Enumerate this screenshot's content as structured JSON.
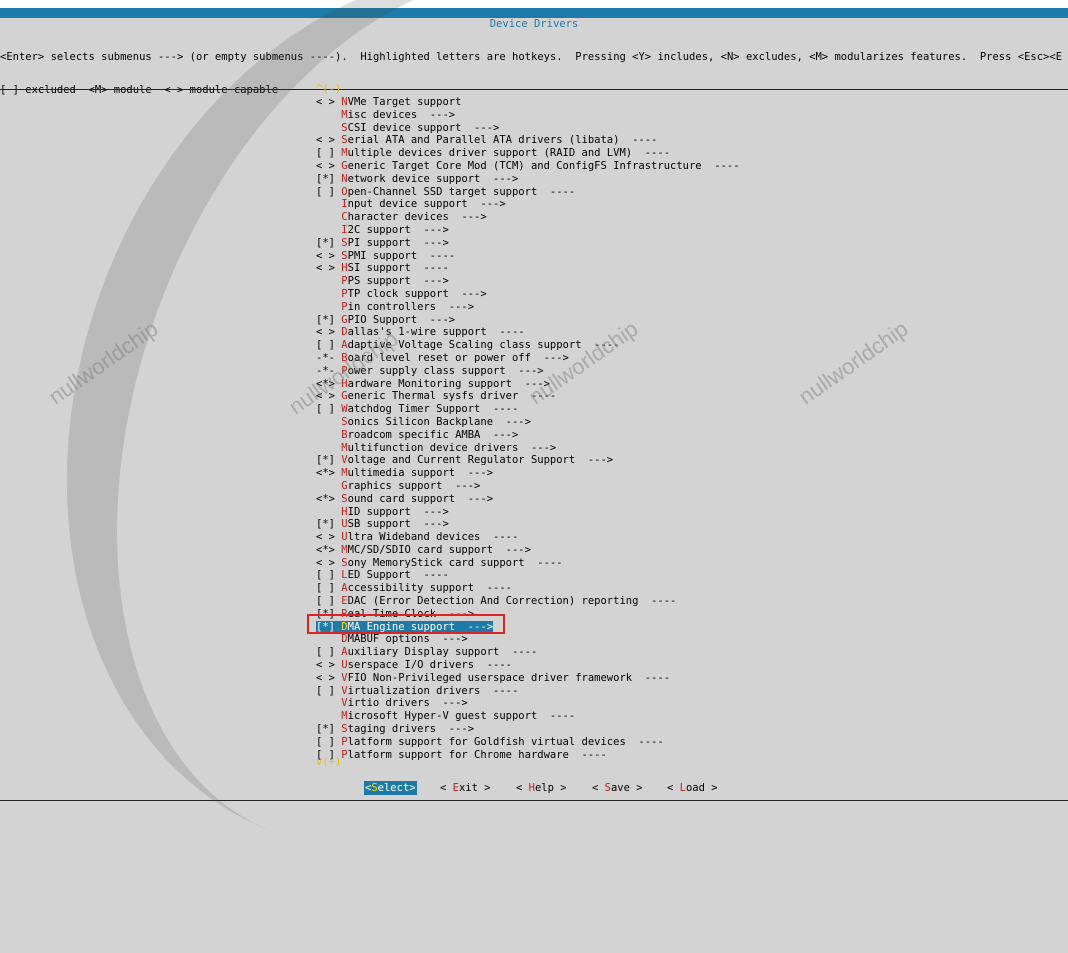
{
  "window": {
    "title": "Device Drivers",
    "help_line1": "<Enter> selects submenus ---> (or empty submenus ----).  Highlighted letters are hotkeys.  Pressing <Y> includes, <N> excludes, <M> modularizes features.  Press <Esc><E",
    "help_line2": "[ ] excluded  <M> module  < > module capable"
  },
  "scroll": {
    "top": "^(-)",
    "bottom": "v(+)"
  },
  "menu": [
    {
      "prefix": "< > ",
      "hot": "N",
      "rest": "VMe Target support"
    },
    {
      "prefix": "    ",
      "hot": "M",
      "rest": "isc devices  --->"
    },
    {
      "prefix": "    ",
      "hot": "S",
      "rest": "CSI device support  --->"
    },
    {
      "prefix": "< > ",
      "hot": "S",
      "rest": "erial ATA and Parallel ATA drivers (libata)  ----"
    },
    {
      "prefix": "[ ] ",
      "hot": "M",
      "rest": "ultiple devices driver support (RAID and LVM)  ----"
    },
    {
      "prefix": "< > ",
      "hot": "G",
      "rest": "eneric Target Core Mod (TCM) and ConfigFS Infrastructure  ----"
    },
    {
      "prefix": "[*] ",
      "hot": "N",
      "rest": "etwork device support  --->"
    },
    {
      "prefix": "[ ] ",
      "hot": "O",
      "rest": "pen-Channel SSD target support  ----"
    },
    {
      "prefix": "    ",
      "hot": "I",
      "rest": "nput device support  --->"
    },
    {
      "prefix": "    ",
      "hot": "C",
      "rest": "haracter devices  --->"
    },
    {
      "prefix": "    ",
      "hot": "I",
      "rest": "2C support  --->"
    },
    {
      "prefix": "[*] ",
      "hot": "S",
      "rest": "PI support  --->"
    },
    {
      "prefix": "< > ",
      "hot": "S",
      "rest": "PMI support  ----"
    },
    {
      "prefix": "< > ",
      "hot": "H",
      "rest": "SI support  ----"
    },
    {
      "prefix": "    ",
      "hot": "P",
      "rest": "PS support  --->"
    },
    {
      "prefix": "    ",
      "hot": "P",
      "rest": "TP clock support  --->"
    },
    {
      "prefix": "    ",
      "hot": "P",
      "rest": "in controllers  --->"
    },
    {
      "prefix": "[*] ",
      "hot": "G",
      "rest": "PIO Support  --->"
    },
    {
      "prefix": "< > ",
      "hot": "D",
      "rest": "allas's 1-wire support  ----"
    },
    {
      "prefix": "[ ] ",
      "hot": "A",
      "rest": "daptive Voltage Scaling class support  ----"
    },
    {
      "prefix": "-*- ",
      "hot": "B",
      "rest": "oard level reset or power off  --->"
    },
    {
      "prefix": "-*- ",
      "hot": "P",
      "rest": "ower supply class support  --->"
    },
    {
      "prefix": "<*> ",
      "hot": "H",
      "rest": "ardware Monitoring support  --->"
    },
    {
      "prefix": "< > ",
      "hot": "G",
      "rest": "eneric Thermal sysfs driver  ----"
    },
    {
      "prefix": "[ ] ",
      "hot": "W",
      "rest": "atchdog Timer Support  ----"
    },
    {
      "prefix": "    ",
      "hot": "S",
      "rest": "onics Silicon Backplane  --->"
    },
    {
      "prefix": "    ",
      "hot": "B",
      "rest": "roadcom specific AMBA  --->"
    },
    {
      "prefix": "    ",
      "hot": "M",
      "rest": "ultifunction device drivers  --->"
    },
    {
      "prefix": "[*] ",
      "hot": "V",
      "rest": "oltage and Current Regulator Support  --->"
    },
    {
      "prefix": "<*> ",
      "hot": "M",
      "rest": "ultimedia support  --->"
    },
    {
      "prefix": "    ",
      "hot": "G",
      "rest": "raphics support  --->"
    },
    {
      "prefix": "<*> ",
      "hot": "S",
      "rest": "ound card support  --->"
    },
    {
      "prefix": "    ",
      "hot": "H",
      "rest": "ID support  --->"
    },
    {
      "prefix": "[*] ",
      "hot": "U",
      "rest": "SB support  --->"
    },
    {
      "prefix": "< > ",
      "hot": "U",
      "rest": "ltra Wideband devices  ----"
    },
    {
      "prefix": "<*> ",
      "hot": "M",
      "rest": "MC/SD/SDIO card support  --->"
    },
    {
      "prefix": "< > ",
      "hot": "S",
      "rest": "ony MemoryStick card support  ----"
    },
    {
      "prefix": "[ ] ",
      "hot": "L",
      "rest": "ED Support  ----"
    },
    {
      "prefix": "[ ] ",
      "hot": "A",
      "rest": "ccessibility support  ----"
    },
    {
      "prefix": "[ ] ",
      "hot": "E",
      "rest": "DAC (Error Detection And Correction) reporting  ----"
    },
    {
      "prefix": "[*] ",
      "hot": "R",
      "rest": "eal Time Clock  --->"
    },
    {
      "prefix": "[*] ",
      "hot": "D",
      "rest": "MA Engine support  --->",
      "selected": true
    },
    {
      "prefix": "    ",
      "hot": "D",
      "rest": "MABUF options  --->"
    },
    {
      "prefix": "[ ] ",
      "hot": "A",
      "rest": "uxiliary Display support  ----"
    },
    {
      "prefix": "< > ",
      "hot": "U",
      "rest": "serspace I/O drivers  ----"
    },
    {
      "prefix": "< > ",
      "hot": "V",
      "rest": "FIO Non-Privileged userspace driver framework  ----"
    },
    {
      "prefix": "[ ] ",
      "hot": "V",
      "rest": "irtualization drivers  ----"
    },
    {
      "prefix": "    ",
      "hot": "V",
      "rest": "irtio drivers  --->"
    },
    {
      "prefix": "    ",
      "hot": "M",
      "rest": "icrosoft Hyper-V guest support  ----"
    },
    {
      "prefix": "[*] ",
      "hot": "S",
      "rest": "taging drivers  --->"
    },
    {
      "prefix": "[ ] ",
      "hot": "P",
      "rest": "latform support for Goldfish virtual devices  ----"
    },
    {
      "prefix": "[ ] ",
      "hot": "P",
      "rest": "latform support for Chrome hardware  ----"
    }
  ],
  "buttons": [
    {
      "name": "select-button",
      "pre": "<",
      "hot": "S",
      "rest": "elect>",
      "active": true
    },
    {
      "name": "exit-button",
      "pre": "< ",
      "hot": "E",
      "rest": "xit >",
      "active": false
    },
    {
      "name": "help-button",
      "pre": "< ",
      "hot": "H",
      "rest": "elp >",
      "active": false
    },
    {
      "name": "save-button",
      "pre": "< ",
      "hot": "S",
      "rest": "ave >",
      "active": false
    },
    {
      "name": "load-button",
      "pre": "< ",
      "hot": "L",
      "rest": "oad >",
      "active": false
    }
  ],
  "watermark": {
    "text": "nullworldchip"
  }
}
